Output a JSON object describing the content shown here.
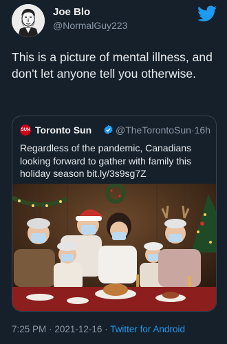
{
  "author": {
    "display_name": "Joe Blo",
    "handle": "@NormalGuy223"
  },
  "tweet": {
    "text": "This is a picture of mental illness, and don't let anyone tell you otherwise."
  },
  "quoted_tweet": {
    "avatar_text": "SUN",
    "display_name": "Toronto Sun",
    "handle": "@TheTorontoSun",
    "separator": "·",
    "age": "16h",
    "text": "Regardless of the pandemic, Canadians looking forward to gather with family this holiday season bit.ly/3s9sg7Z"
  },
  "footer": {
    "time": "7:25 PM",
    "separator": "·",
    "date": "2021-12-16",
    "source": "Twitter for Android"
  },
  "icons": {
    "logo": "twitter-bird-icon",
    "verified": "verified-badge-icon"
  },
  "colors": {
    "background": "#15202b",
    "accent": "#1d9bf0",
    "muted": "#8b98a5",
    "sun_red": "#d0021b"
  }
}
